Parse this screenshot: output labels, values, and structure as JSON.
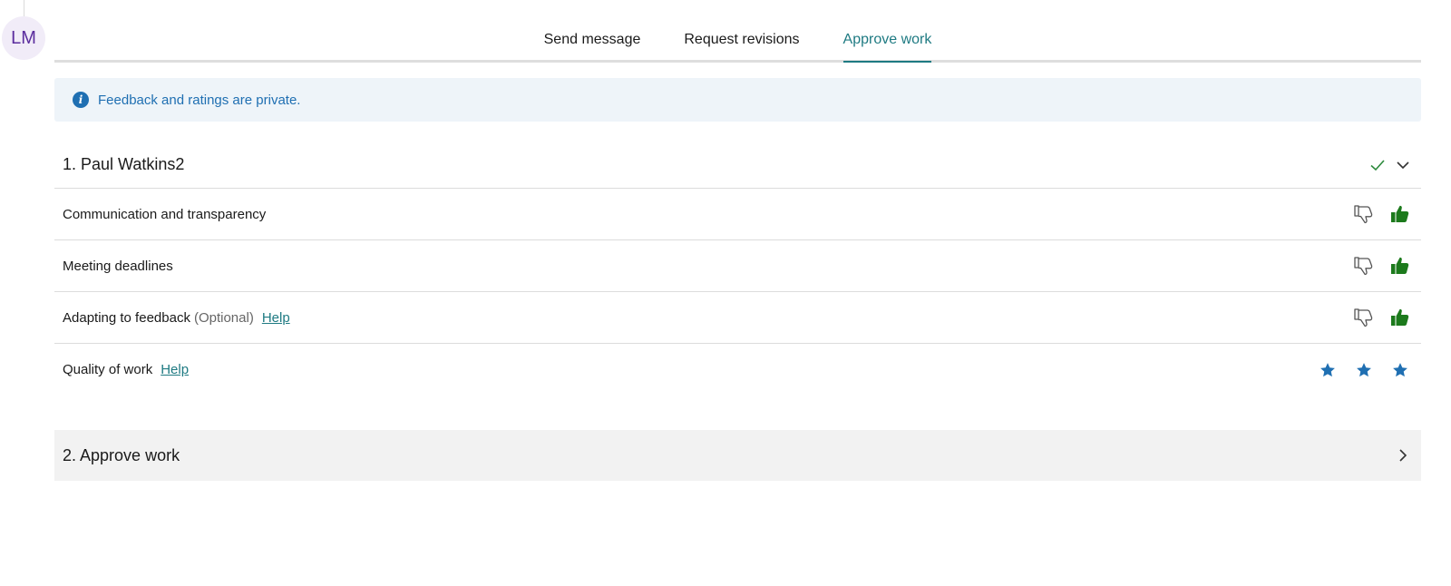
{
  "avatar": {
    "initials": "LM"
  },
  "tabs": [
    {
      "label": "Send message",
      "active": false
    },
    {
      "label": "Request revisions",
      "active": false
    },
    {
      "label": "Approve work",
      "active": true
    }
  ],
  "info_banner": {
    "icon": "info-icon",
    "text": "Feedback and ratings are private."
  },
  "section1": {
    "title": "1. Paul Watkins2",
    "icons": [
      "check-icon",
      "chevron-down-icon"
    ],
    "rows": [
      {
        "label": "Communication and transparency",
        "type": "thumbs",
        "selected": "up"
      },
      {
        "label": "Meeting deadlines",
        "type": "thumbs",
        "selected": "up"
      },
      {
        "label": "Adapting to feedback",
        "optional": "(Optional)",
        "help": "Help",
        "type": "thumbs",
        "selected": "up"
      },
      {
        "label": "Quality of work",
        "help": "Help",
        "type": "stars",
        "rating": 3
      }
    ]
  },
  "section2": {
    "title": "2. Approve work",
    "icon": "chevron-right-icon"
  },
  "colors": {
    "accent": "#1e7a82",
    "info": "#1f6fb2",
    "thumb_up": "#1c7a1c",
    "star": "#1f6fb2",
    "avatar_text": "#5b2d9e"
  }
}
